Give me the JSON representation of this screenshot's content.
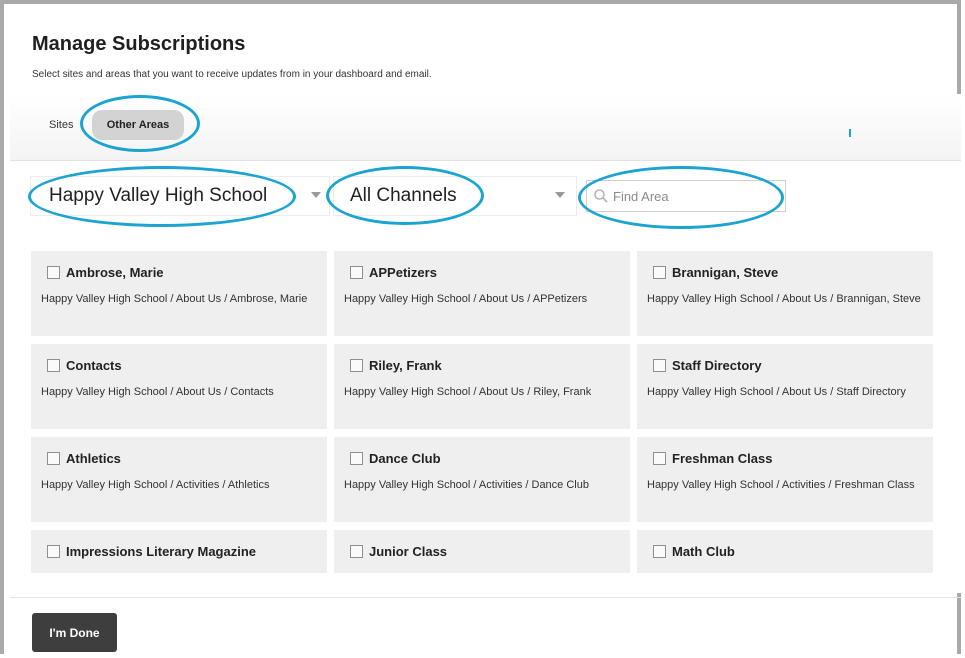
{
  "header": {
    "title": "Manage Subscriptions",
    "subtitle": "Select sites and areas that you want to receive updates from in your dashboard and email."
  },
  "tabs": {
    "sites_label": "Sites",
    "other_label": "Other Areas",
    "active": "Other Areas"
  },
  "filters": {
    "site_select": "Happy Valley High School",
    "channel_select": "All Channels",
    "search_placeholder": "Find Area",
    "search_value": ""
  },
  "areas": [
    {
      "name": "Ambrose, Marie",
      "path": "Happy Valley High School / About Us / Ambrose, Marie"
    },
    {
      "name": "APPetizers",
      "path": "Happy Valley High School / About Us / APPetizers"
    },
    {
      "name": "Brannigan, Steve",
      "path": "Happy Valley High School / About Us / Brannigan, Steve"
    },
    {
      "name": "Contacts",
      "path": "Happy Valley High School / About Us / Contacts"
    },
    {
      "name": "Riley, Frank",
      "path": "Happy Valley High School / About Us / Riley, Frank"
    },
    {
      "name": "Staff Directory",
      "path": "Happy Valley High School / About Us / Staff Directory"
    },
    {
      "name": "Athletics",
      "path": "Happy Valley High School / Activities / Athletics"
    },
    {
      "name": "Dance Club",
      "path": "Happy Valley High School / Activities / Dance Club"
    },
    {
      "name": "Freshman Class",
      "path": "Happy Valley High School / Activities / Freshman Class"
    },
    {
      "name": "Impressions Literary Magazine",
      "path": ""
    },
    {
      "name": "Junior Class",
      "path": ""
    },
    {
      "name": "Math Club",
      "path": ""
    }
  ],
  "footer": {
    "done_label": "I'm Done"
  },
  "colors": {
    "highlight": "#1ba3d1",
    "card_bg": "#efefef",
    "button_bg": "#3e3e3e"
  }
}
